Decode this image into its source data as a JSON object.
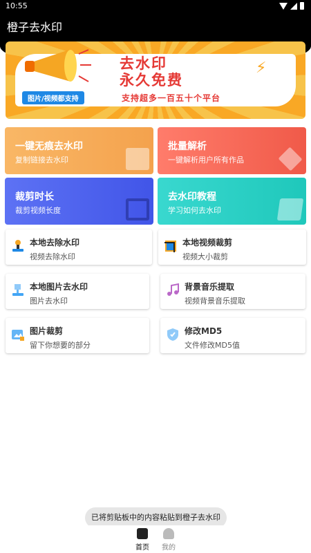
{
  "status": {
    "time": "10:55"
  },
  "app": {
    "title": "橙子去水印"
  },
  "banner": {
    "line1": "去水印",
    "line2": "永久免费",
    "tag": "图片/视频都支持",
    "sub": "支持超多一百五十个平台"
  },
  "feature_cards": [
    {
      "title": "一键无痕去水印",
      "subtitle": "复制链接去水印",
      "icon": "clapperboard-icon",
      "color": "#f4a24d"
    },
    {
      "title": "批量解析",
      "subtitle": "一键解析用户所有作品",
      "icon": "layers-icon",
      "color": "#f05a49"
    },
    {
      "title": "裁剪时长",
      "subtitle": "裁剪视频长度",
      "icon": "crop-icon",
      "color": "#4155e8"
    },
    {
      "title": "去水印教程",
      "subtitle": "学习如何去水印",
      "icon": "book-icon",
      "color": "#1fc8bb"
    }
  ],
  "tools": [
    {
      "title": "本地去除水印",
      "subtitle": "视频去除水印",
      "icon": "stamp-icon"
    },
    {
      "title": "本地视频裁剪",
      "subtitle": "视频大小裁剪",
      "icon": "video-crop-icon"
    },
    {
      "title": "本地图片去水印",
      "subtitle": "图片去水印",
      "icon": "image-stamp-icon"
    },
    {
      "title": "背景音乐提取",
      "subtitle": "视频背景音乐提取",
      "icon": "music-notes-icon"
    },
    {
      "title": "图片裁剪",
      "subtitle": "留下你想要的部分",
      "icon": "image-crop-icon"
    },
    {
      "title": "修改MD5",
      "subtitle": "文件修改MD5值",
      "icon": "shield-icon"
    }
  ],
  "toast": "已将剪贴板中的内容粘贴到橙子去水印",
  "nav": {
    "home": "首页",
    "mine": "我的"
  }
}
